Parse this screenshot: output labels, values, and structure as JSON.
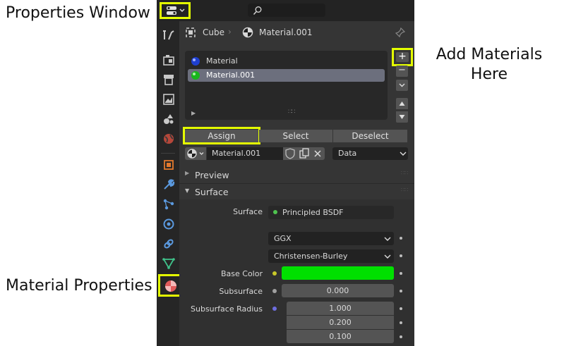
{
  "annotations": {
    "properties_window": "Properties Window",
    "material_properties": "Material Properties",
    "add_materials_line1": "Add Materials",
    "add_materials_line2": "Here"
  },
  "header": {
    "object_name": "Cube",
    "material_name": "Material.001"
  },
  "material_slots": [
    {
      "label": "Material"
    },
    {
      "label": "Material.001",
      "selected": true
    }
  ],
  "slot_buttons": {
    "add": "+",
    "remove": "−"
  },
  "actions": {
    "assign": "Assign",
    "select": "Select",
    "deselect": "Deselect"
  },
  "material_selector": {
    "value": "Material.001",
    "link": "Data"
  },
  "sections": {
    "preview": "Preview",
    "surface": "Surface"
  },
  "surface": {
    "surface_label": "Surface",
    "surface_value": "Principled BSDF",
    "distribution": "GGX",
    "subsurface_method": "Christensen-Burley",
    "base_color_label": "Base Color",
    "base_color": "#00e000",
    "subsurface_label": "Subsurface",
    "subsurface_value": "0.000",
    "subsurface_radius_label": "Subsurface Radius",
    "subsurface_radius": [
      "1.000",
      "0.200",
      "0.100"
    ]
  },
  "colors": {
    "highlight": "#e5ff00",
    "selected_row": "#6c6f7d"
  }
}
